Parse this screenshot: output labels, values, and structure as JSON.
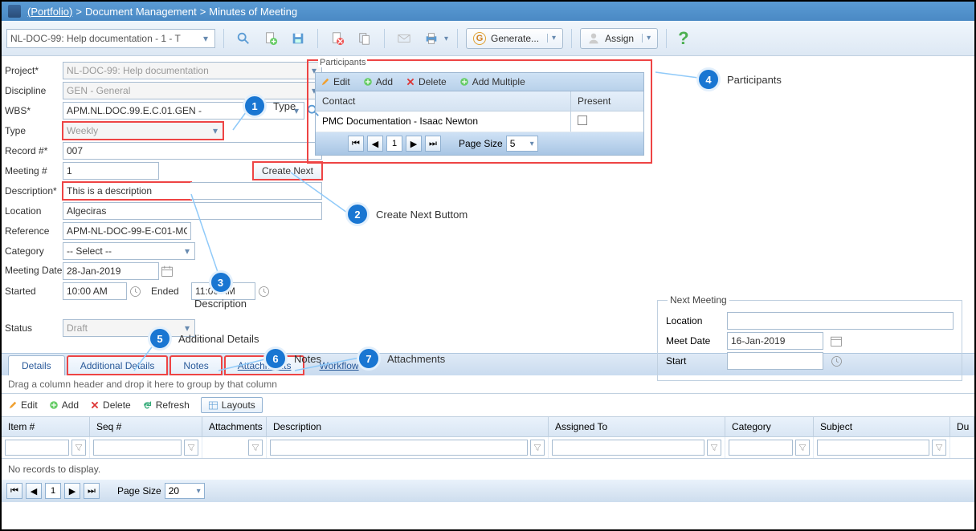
{
  "breadcrumb": {
    "portfolio": "(Portfolio)",
    "sep": ">",
    "doc_mgmt": "Document Management",
    "minutes": "Minutes of Meeting"
  },
  "doc_selector": "NL-DOC-99: Help documentation - 1 - T",
  "toolbar": {
    "generate": "Generate...",
    "assign": "Assign"
  },
  "form": {
    "project_lbl": "Project*",
    "project": "NL-DOC-99: Help documentation",
    "discipline_lbl": "Discipline",
    "discipline": "GEN - General",
    "wbs_lbl": "WBS*",
    "wbs": "APM.NL.DOC.99.E.C.01.GEN -",
    "type_lbl": "Type",
    "type": "Weekly",
    "record_lbl": "Record #*",
    "record": "007",
    "meeting_lbl": "Meeting #",
    "meeting": "1",
    "create_next": "Create Next",
    "descr_lbl": "Description*",
    "descr": "This is a description",
    "location_lbl": "Location",
    "location": "Algeciras",
    "reference_lbl": "Reference",
    "reference": "APM-NL-DOC-99-E-C01-MC",
    "category_lbl": "Category",
    "category": "-- Select --",
    "meetdate_lbl": "Meeting Date",
    "meetdate": "28-Jan-2019",
    "started_lbl": "Started",
    "started": "10:00 AM",
    "ended_lbl": "Ended",
    "ended": "11:00 AM",
    "status_lbl": "Status",
    "status": "Draft"
  },
  "participants": {
    "title": "Participants",
    "edit": "Edit",
    "add": "Add",
    "delete": "Delete",
    "add_multiple": "Add Multiple",
    "col_contact": "Contact",
    "col_present": "Present",
    "rows": [
      {
        "contact": "PMC Documentation - Isaac Newton",
        "present": false
      }
    ],
    "page_size_lbl": "Page Size",
    "page": "1",
    "page_size": "5"
  },
  "next_meeting": {
    "title": "Next Meeting",
    "location_lbl": "Location",
    "location": "",
    "meetdate_lbl": "Meet Date",
    "meetdate": "16-Jan-2019",
    "start_lbl": "Start",
    "start": ""
  },
  "tabs": {
    "details": "Details",
    "additional": "Additional Details",
    "notes": "Notes",
    "attachments": "Attachments",
    "workflow": "Workflow"
  },
  "grid": {
    "groupby": "Drag a column header and drop it here to group by that column",
    "edit": "Edit",
    "add": "Add",
    "delete": "Delete",
    "refresh": "Refresh",
    "layouts": "Layouts",
    "cols": {
      "item": "Item #",
      "seq": "Seq #",
      "att": "Attachments",
      "desc": "Description",
      "asg": "Assigned To",
      "cat": "Category",
      "subj": "Subject",
      "du": "Du"
    },
    "empty": "No records to display.",
    "page": "1",
    "page_size_lbl": "Page Size",
    "page_size": "20"
  },
  "callouts": {
    "c1": "Type",
    "c2": "Create Next Buttom",
    "c3": "Description",
    "c4": "Participants",
    "c5": "Additional Details",
    "c6": "Notes",
    "c7": "Attachments"
  }
}
